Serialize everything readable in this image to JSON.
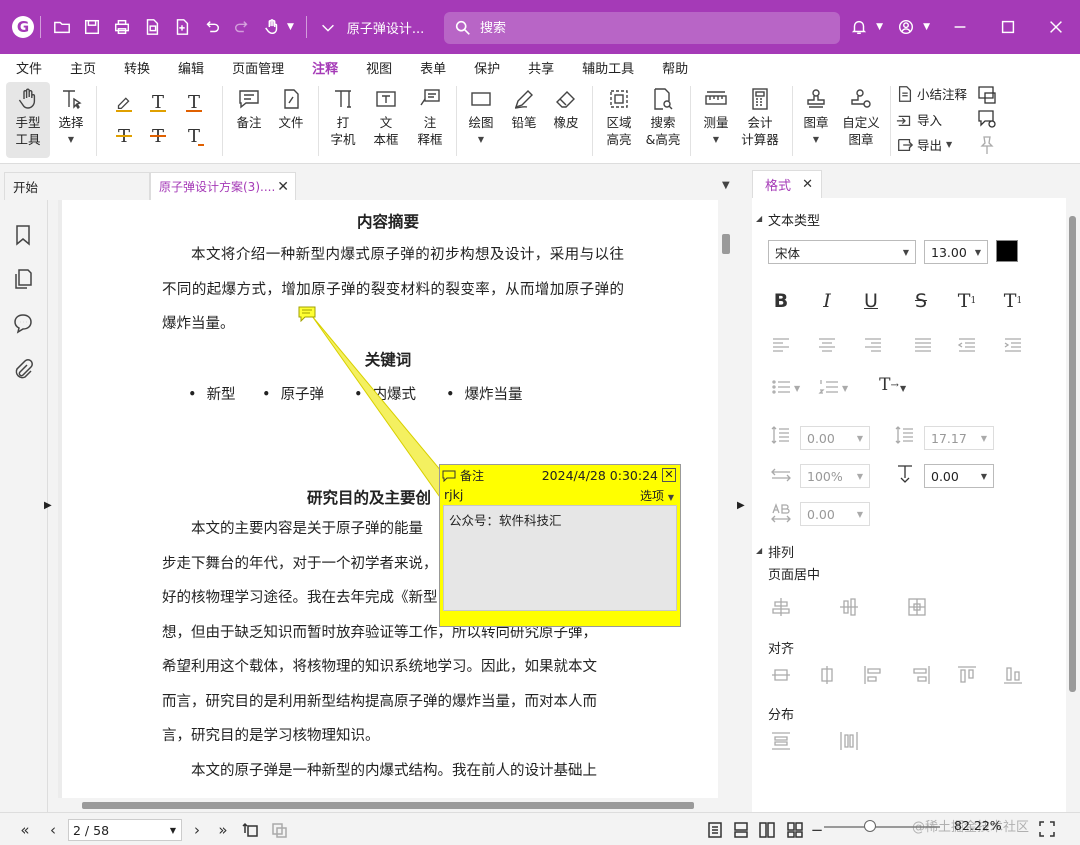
{
  "titlebar": {
    "doc_title": "原子弹设计...",
    "search_placeholder": "搜索"
  },
  "menu": [
    "文件",
    "主页",
    "转换",
    "编辑",
    "页面管理",
    "注释",
    "视图",
    "表单",
    "保护",
    "共享",
    "辅助工具",
    "帮助"
  ],
  "menu_active": "注释",
  "ribbon": {
    "hand_tool": "手型\n工具",
    "select": "选择",
    "note": "备注",
    "file": "文件",
    "typewriter": "打\n字机",
    "textbox": "文\n本框",
    "callout": "注\n释框",
    "draw": "绘图",
    "pencil": "铅笔",
    "eraser": "橡皮",
    "area_highlight": "区域\n高亮",
    "search_highlight": "搜索\n&高亮",
    "measure": "测量",
    "calculator": "会计\n计算器",
    "stamp": "图章",
    "custom_stamp": "自定义\n图章",
    "summarize": "小结注释",
    "import": "导入",
    "export": "导出"
  },
  "tabs": {
    "start": "开始",
    "doc": "原子弹设计方案(3)...."
  },
  "document": {
    "heading_abstract": "内容摘要",
    "abstract": "本文将介绍一种新型内爆式原子弹的初步构想及设计，采用与以往不同的起爆方式，增加原子弹的裂变材料的裂变率，从而增加原子弹的爆炸当量。",
    "heading_keywords": "关键词",
    "keywords": [
      "新型",
      "原子弹",
      "内爆式",
      "爆炸当量"
    ],
    "heading_purpose": "研究目的及主要创",
    "p1_lines": [
      "本文的主要内容是关于原子弹的能量",
      "步走下舞台的年代，对于一个初学者来说，",
      "好的核物理学习途径。我在去年完成《新型",
      "想，但由于缺乏知识而暂时放弃验证等工作，所以转向研究原子弹，",
      "希望利用这个载体，将核物理的知识系统地学习。因此，如果就本文",
      "而言，研究目的是利用新型结构提高原子弹的爆炸当量，而对本人而",
      "言，研究目的是学习核物理知识。"
    ],
    "p2_line": "本文的原子弹是一种新型的内爆式结构。我在前人的设计基础上"
  },
  "note": {
    "title": "备注",
    "date": "2024/4/28 0:30:24",
    "author": "rjkj",
    "options": "选项",
    "body": "公众号：软件科技汇"
  },
  "format_panel": {
    "tab": "格式",
    "text_type": "文本类型",
    "font": "宋体",
    "font_size": "13.00",
    "line_spacing": "0.00",
    "para_spacing": "17.17",
    "scale": "100%",
    "baseline": "0.00",
    "char_spacing": "0.00",
    "arrange": "排列",
    "page_center": "页面居中",
    "align": "对齐",
    "distribute": "分布",
    "text_color": "#000000"
  },
  "status": {
    "page": "2 / 58",
    "zoom": "82.22%",
    "watermark": "@稀土掘金技术社区"
  },
  "colors": {
    "accent": "#a53ab7",
    "note_yellow": "#ffff00"
  }
}
